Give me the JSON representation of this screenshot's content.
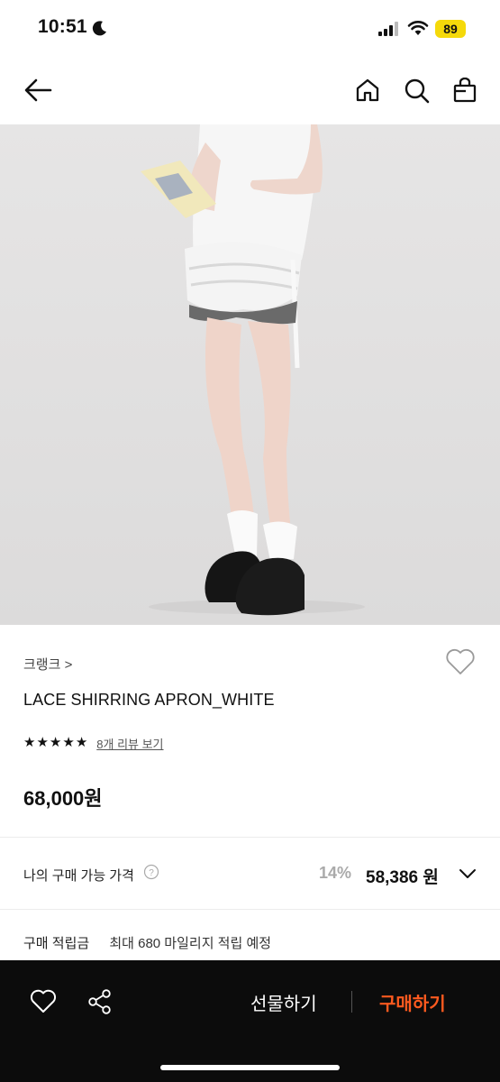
{
  "status_bar": {
    "time": "10:51",
    "battery": "89"
  },
  "product": {
    "brand": "크랭크 >",
    "name": "LACE SHIRRING APRON_WHITE",
    "rating": 5,
    "review_link": "8개 리뷰 보기",
    "price": "68,000원"
  },
  "my_price": {
    "label": "나의 구매 가능 가격",
    "discount_rate": "14%",
    "discount_price": "58,386 원"
  },
  "points": {
    "label": "구매 적립금",
    "value": "최대 680 마일리지 적립 예정"
  },
  "bottom_bar": {
    "gift_label": "선물하기",
    "buy_label": "구매하기"
  },
  "colors": {
    "buy_accent": "#ff5a1f",
    "battery_badge": "#f5d90a",
    "bottom_bar_bg": "#0c0c0c"
  },
  "icons": [
    "moon-icon",
    "signal-icon",
    "wifi-icon",
    "back-arrow-icon",
    "home-icon",
    "search-icon",
    "shopping-bag-icon",
    "heart-icon",
    "star-icon",
    "help-circle-icon",
    "chevron-down-icon",
    "share-icon"
  ]
}
